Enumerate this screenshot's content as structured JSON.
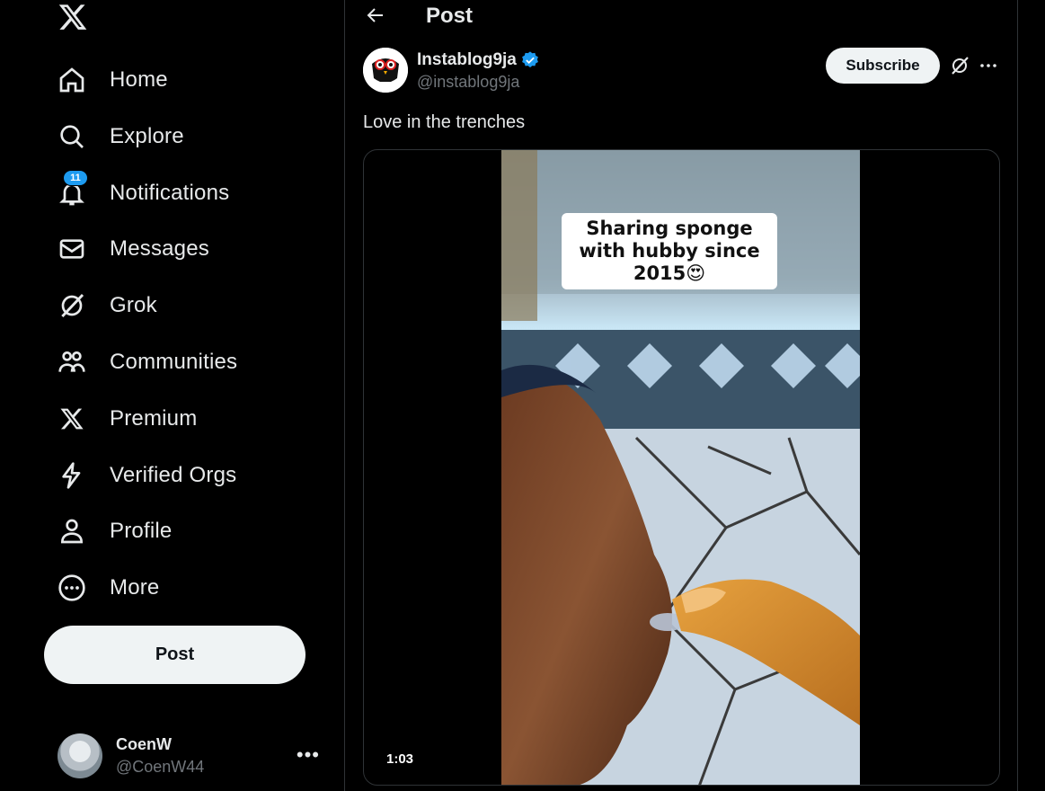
{
  "nav": {
    "items": [
      {
        "label": "Home",
        "icon": "home-icon"
      },
      {
        "label": "Explore",
        "icon": "search-icon"
      },
      {
        "label": "Notifications",
        "icon": "bell-icon",
        "badge": "11"
      },
      {
        "label": "Messages",
        "icon": "envelope-icon"
      },
      {
        "label": "Grok",
        "icon": "grok-icon"
      },
      {
        "label": "Communities",
        "icon": "people-icon"
      },
      {
        "label": "Premium",
        "icon": "x-logo-icon"
      },
      {
        "label": "Verified Orgs",
        "icon": "lightning-icon"
      },
      {
        "label": "Profile",
        "icon": "person-icon"
      },
      {
        "label": "More",
        "icon": "more-circle-icon"
      }
    ],
    "post_button": "Post"
  },
  "account": {
    "name": "CoenW",
    "handle": "@CoenW44"
  },
  "header": {
    "title": "Post"
  },
  "tweet": {
    "author_name": "Instablog9ja",
    "author_handle": "@instablog9ja",
    "subscribe_label": "Subscribe",
    "text": "Love in the trenches",
    "video_caption": "Sharing sponge with hubby since 2015😍",
    "video_duration": "1:03"
  },
  "colors": {
    "accent": "#1d9bf0",
    "background": "#000000",
    "text": "#e7e9ea",
    "muted": "#71767b"
  }
}
